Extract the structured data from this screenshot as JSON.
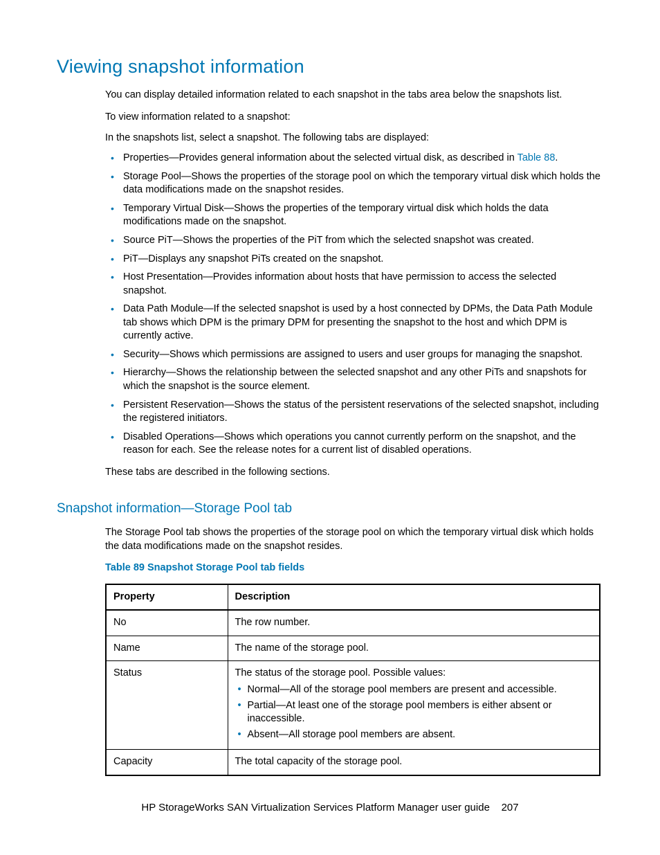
{
  "h1": "Viewing snapshot information",
  "intro1": "You can display detailed information related to each snapshot in the tabs area below the snapshots list.",
  "intro2": "To view information related to a snapshot:",
  "intro3": "In the snapshots list, select a snapshot. The following tabs are displayed:",
  "tabs": [
    {
      "pre": "Properties—Provides general information about the selected virtual disk, as described in ",
      "link": "Table 88",
      "post": "."
    },
    {
      "text": "Storage Pool—Shows the properties of the storage pool on which the temporary virtual disk which holds the data modifications made on the snapshot resides."
    },
    {
      "text": "Temporary Virtual Disk—Shows the properties of the temporary virtual disk which holds the data modifications made on the snapshot."
    },
    {
      "text": "Source PiT—Shows the properties of the PiT from which the selected snapshot was created."
    },
    {
      "text": "PiT—Displays any snapshot PiTs created on the snapshot."
    },
    {
      "text": "Host Presentation—Provides information about hosts that have permission to access the selected snapshot."
    },
    {
      "text": "Data Path Module—If the selected snapshot is used by a host connected by DPMs, the Data Path Module tab shows which DPM is the primary DPM for presenting the snapshot to the host and which DPM is currently active."
    },
    {
      "text": "Security—Shows which permissions are assigned to users and user groups for managing the snapshot."
    },
    {
      "text": "Hierarchy—Shows the relationship between the selected snapshot and any other PiTs and snapshots for which the snapshot is the source element."
    },
    {
      "text": "Persistent Reservation—Shows the status of the persistent reservations of the selected snapshot, including the registered initiators."
    },
    {
      "text": "Disabled Operations—Shows which operations you cannot currently perform on the snapshot, and the reason for each. See the release notes for a current list of disabled operations."
    }
  ],
  "outro": "These tabs are described in the following sections.",
  "h2": "Snapshot information—Storage Pool tab",
  "sp_intro": "The Storage Pool tab shows the properties of the storage pool on which the temporary virtual disk which holds the data modifications made on the snapshot resides.",
  "tablecap": "Table 89 Snapshot Storage Pool tab fields",
  "th_prop": "Property",
  "th_desc": "Description",
  "rows": [
    {
      "prop": "No",
      "desc": "The row number."
    },
    {
      "prop": "Name",
      "desc": "The name of the storage pool."
    },
    {
      "prop": "Status",
      "desc_intro": "The status of the storage pool. Possible values:",
      "items": [
        "Normal—All of the storage pool members are present and accessible.",
        "Partial—At least one of the storage pool members is either absent or inaccessible.",
        "Absent—All storage pool members are absent."
      ]
    },
    {
      "prop": "Capacity",
      "desc": "The total capacity of the storage pool."
    }
  ],
  "footer_title": "HP StorageWorks SAN Virtualization Services Platform Manager user guide",
  "footer_page": "207"
}
